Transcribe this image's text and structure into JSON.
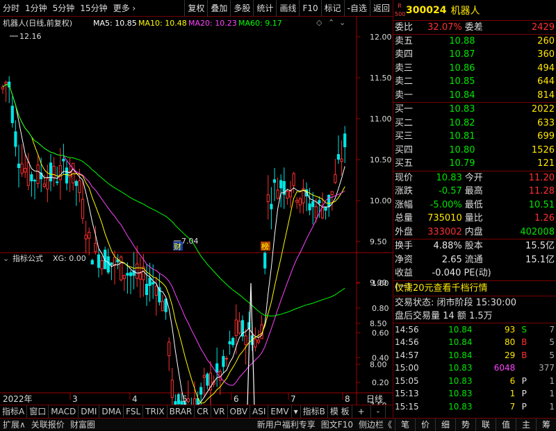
{
  "toolbar": {
    "left": [
      "分时",
      "1分钟",
      "5分钟",
      "15分钟",
      "更多 ›"
    ],
    "right": [
      "复权",
      "叠加",
      "多股",
      "统计",
      "画线",
      "F10",
      "标记",
      "-自选",
      "返回"
    ]
  },
  "main_chart": {
    "title": "机器人(日线,前复权)",
    "ma": [
      {
        "label": "MA5: 10.85",
        "color": "#ffffff"
      },
      {
        "label": "MA10: 10.48",
        "color": "#ffff00"
      },
      {
        "label": "MA20: 10.23",
        "color": "#ff44ff"
      },
      {
        "label": "MA60: 9.17",
        "color": "#00ff00"
      }
    ],
    "high_label": "12.16",
    "low_label": "7.04",
    "ticks": [
      "12.00",
      "11.50",
      "11.00",
      "10.50",
      "10.00",
      "9.50",
      "9.00",
      "8.50",
      "8.00",
      "7.50",
      "7.00"
    ],
    "marker_cai": "财",
    "marker_bang": "榜"
  },
  "indicator": {
    "title": "指标公式",
    "value": "XG: 0.00",
    "ticks": [
      "1.00",
      "0.80",
      "0.60",
      "0.40",
      "0.20"
    ]
  },
  "xaxis": {
    "year": "2022年",
    "months": [
      "3",
      "4",
      "5",
      "6",
      "7",
      "8"
    ],
    "period": "日线"
  },
  "tabs": [
    "指标A",
    "窗口",
    "MACD",
    "DMI",
    "DMA",
    "FSL",
    "TRIX",
    "BRAR",
    "CR",
    "VR",
    "OBV",
    "ASI",
    "EMV",
    "▾",
    "指标B",
    "模 板",
    "+",
    "-"
  ],
  "quote": {
    "badge_top": "R",
    "badge_bottom": "500",
    "code": "300024",
    "name": "机器人",
    "webi": {
      "l1": "委比",
      "v1": "32.07%",
      "l2": "委差",
      "v2": "2429"
    },
    "asks": [
      {
        "label": "卖五",
        "price": "10.88",
        "vol": "260"
      },
      {
        "label": "卖四",
        "price": "10.87",
        "vol": "360"
      },
      {
        "label": "卖三",
        "price": "10.86",
        "vol": "494"
      },
      {
        "label": "卖二",
        "price": "10.85",
        "vol": "644"
      },
      {
        "label": "卖一",
        "price": "10.84",
        "vol": "814"
      }
    ],
    "bids": [
      {
        "label": "买一",
        "price": "10.83",
        "vol": "2022"
      },
      {
        "label": "买二",
        "price": "10.82",
        "vol": "633"
      },
      {
        "label": "买三",
        "price": "10.81",
        "vol": "699"
      },
      {
        "label": "买四",
        "price": "10.80",
        "vol": "1526"
      },
      {
        "label": "买五",
        "price": "10.79",
        "vol": "121"
      }
    ],
    "stats": [
      {
        "l1": "现价",
        "v1": "10.83",
        "c1": "green",
        "l2": "今开",
        "v2": "11.20",
        "c2": "red"
      },
      {
        "l1": "涨跌",
        "v1": "-0.57",
        "c1": "green",
        "l2": "最高",
        "v2": "11.28",
        "c2": "red"
      },
      {
        "l1": "涨幅",
        "v1": "-5.00%",
        "c1": "green",
        "l2": "最低",
        "v2": "10.51",
        "c2": "green"
      },
      {
        "l1": "总量",
        "v1": "735010",
        "c1": "yellow",
        "l2": "量比",
        "v2": "1.26",
        "c2": "red"
      },
      {
        "l1": "外盘",
        "v1": "333002",
        "c1": "red",
        "l2": "内盘",
        "v2": "402008",
        "c2": "green"
      }
    ],
    "finance": [
      {
        "l1": "换手",
        "v1": "4.88%",
        "l2": "股本",
        "v2": "15.5亿"
      },
      {
        "l1": "净资",
        "v1": "2.65",
        "l2": "流通",
        "v2": "15.1亿"
      },
      {
        "l1": "收益(一)",
        "v1": "-0.040",
        "l2": "PE(动)",
        "v2": ""
      }
    ],
    "promo": "仅需20元查看千档行情",
    "status": "交易状态: 闭市阶段 15:30:00",
    "after": "盘后交易量 14 额 1.5万",
    "ticks": [
      {
        "t": "14:56",
        "p": "10.84",
        "v": "93",
        "vc": "yellow",
        "s": "S",
        "sc": "green",
        "n": "7"
      },
      {
        "t": "14:56",
        "p": "10.84",
        "v": "80",
        "vc": "yellow",
        "s": "B",
        "sc": "red",
        "n": "5"
      },
      {
        "t": "14:57",
        "p": "10.84",
        "v": "29",
        "vc": "yellow",
        "s": "B",
        "sc": "red",
        "n": "5"
      },
      {
        "t": "15:00",
        "p": "10.83",
        "v": "6048",
        "vc": "purple",
        "s": "",
        "sc": "white",
        "n": "377"
      },
      {
        "t": "15:05",
        "p": "10.83",
        "v": "6",
        "vc": "yellow",
        "s": "P",
        "sc": "white",
        "n": "1"
      },
      {
        "t": "15:13",
        "p": "10.83",
        "v": "1",
        "vc": "yellow",
        "s": "P",
        "sc": "white",
        "n": "1"
      },
      {
        "t": "15:15",
        "p": "10.83",
        "v": "7",
        "vc": "yellow",
        "s": "P",
        "sc": "white",
        "n": "1"
      }
    ]
  },
  "bottombar": {
    "left": [
      "扩展∧",
      "关联报价",
      "财富圈"
    ],
    "mid": [
      "新用户福利专享",
      "图文F10",
      "侧边栏《"
    ],
    "right": [
      "笔",
      "价",
      "细",
      "势",
      "联",
      "值",
      "主",
      "筹"
    ]
  }
}
